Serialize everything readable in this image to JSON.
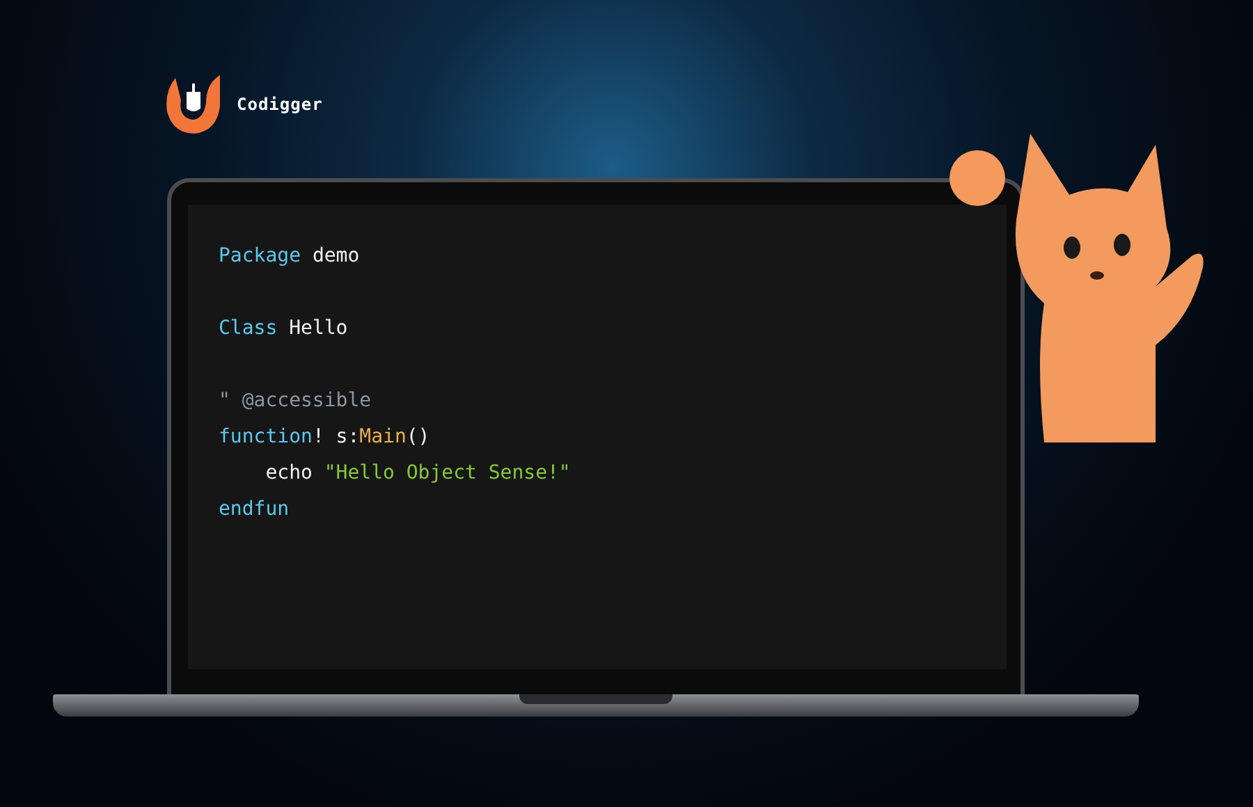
{
  "brand": {
    "name": "Codigger"
  },
  "code": {
    "lines": [
      {
        "kind": "code",
        "tokens": [
          {
            "kind": "keyword",
            "text": "Package"
          },
          {
            "kind": "plain",
            "text": " demo"
          }
        ]
      },
      {
        "kind": "blank"
      },
      {
        "kind": "code",
        "tokens": [
          {
            "kind": "keyword",
            "text": "Class"
          },
          {
            "kind": "plain",
            "text": " Hello"
          }
        ]
      },
      {
        "kind": "blank"
      },
      {
        "kind": "code",
        "tokens": [
          {
            "kind": "comment",
            "text": "\" @accessible"
          }
        ]
      },
      {
        "kind": "code",
        "tokens": [
          {
            "kind": "keyword",
            "text": "function"
          },
          {
            "kind": "plain",
            "text": "! s:"
          },
          {
            "kind": "function",
            "text": "Main"
          },
          {
            "kind": "plain",
            "text": "()"
          }
        ]
      },
      {
        "kind": "code",
        "tokens": [
          {
            "kind": "plain",
            "text": "    echo "
          },
          {
            "kind": "string",
            "text": "\"Hello Object Sense!\""
          }
        ]
      },
      {
        "kind": "code",
        "tokens": [
          {
            "kind": "keyword",
            "text": "endfun"
          }
        ]
      }
    ]
  }
}
